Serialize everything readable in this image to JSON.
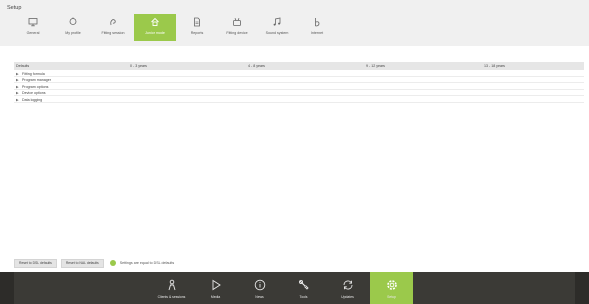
{
  "window": {
    "title": "Setup"
  },
  "toolbar": {
    "items": [
      {
        "label": "General",
        "icon": "monitor-icon"
      },
      {
        "label": "My profile",
        "icon": "user-profile-icon"
      },
      {
        "label": "Fitting session",
        "icon": "fitting-session-icon"
      },
      {
        "label": "Junior mode",
        "icon": "junior-mode-icon",
        "active": true
      },
      {
        "label": "Reports",
        "icon": "document-icon"
      },
      {
        "label": "Fitting device",
        "icon": "fitting-device-icon"
      },
      {
        "label": "Sound system",
        "icon": "music-note-icon"
      },
      {
        "label": "Internet",
        "icon": "internet-icon"
      }
    ]
  },
  "table": {
    "headers": [
      "Defaults",
      "0 - 3 years",
      "4 - 8 years",
      "9 - 12 years",
      "13 - 18 years"
    ],
    "rows": [
      "Fitting formula",
      "Program manager",
      "Program options",
      "Device options",
      "Data logging"
    ]
  },
  "footer": {
    "reset_dsl": "Reset to DSL defaults",
    "reset_nal": "Reset to NAL defaults",
    "status": "Settings are equal to DSL defaults"
  },
  "nav": {
    "items": [
      {
        "label": "Clients & sessions",
        "icon": "person-icon"
      },
      {
        "label": "Media",
        "icon": "play-icon"
      },
      {
        "label": "News",
        "icon": "info-icon"
      },
      {
        "label": "Tools",
        "icon": "tools-icon"
      },
      {
        "label": "Updates",
        "icon": "sync-icon"
      },
      {
        "label": "Setup",
        "icon": "gear-icon",
        "active": true
      }
    ]
  },
  "colors": {
    "accent": "#9bc94b",
    "nav_background": "#3b3a36",
    "titlebar_background": "#f0f0f0"
  }
}
